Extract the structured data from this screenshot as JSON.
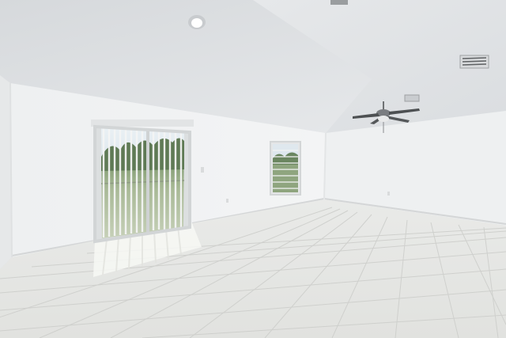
{
  "scene": {
    "subject": "empty-living-room-interior",
    "colors": {
      "wall_left": "#eceeef",
      "wall_back": "#f1f2f3",
      "wall_right": "#eff0f1",
      "ceiling": "#e3e5e7",
      "floor_tile": "#e4e5e3",
      "grout": "#c9cac6",
      "outdoor_green": "#9db08a",
      "sky": "#e9f0f4"
    }
  }
}
